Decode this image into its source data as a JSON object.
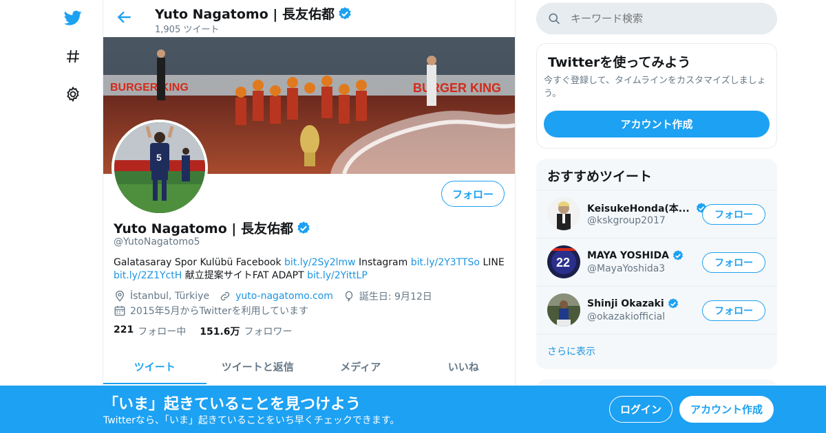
{
  "colors": {
    "accent": "#1da1f2",
    "link": "#1b95e0",
    "muted": "#657786",
    "text": "#14171a",
    "border": "#e6ecf0",
    "panel": "#f5f8fa"
  },
  "nav": {
    "icons": [
      "twitter-bird-icon",
      "hashtag-icon",
      "gear-icon"
    ]
  },
  "header": {
    "name": "Yuto Nagatomo | 長友佑都",
    "tweet_count": "1,905 ツイート"
  },
  "profile": {
    "name": "Yuto Nagatomo | 長友佑都",
    "handle": "@YutoNagatomo5",
    "follow_label": "フォロー",
    "bio": {
      "t1": "Galatasaray Spor Kulübü Facebook ",
      "l1": "bit.ly/2Sy2lmw",
      "t2": " Instagram ",
      "l2": "bit.ly/2Y3TTSo",
      "t3": " LINE ",
      "l3": "bit.ly/2Z1YctH",
      "t4": " 献立提案サイトFAT ADAPT ",
      "l4": "bit.ly/2YittLP"
    },
    "location": "İstanbul, Türkiye",
    "website": "yuto-nagatomo.com",
    "birthday": "誕生日: 9月12日",
    "joined": "2015年5月からTwitterを利用しています",
    "following_count": "221",
    "following_label": "フォロー中",
    "followers_count": "151.6万",
    "followers_label": "フォロワー"
  },
  "tabs": [
    "ツイート",
    "ツイートと返信",
    "メディア",
    "いいね"
  ],
  "search": {
    "placeholder": "キーワード検索"
  },
  "signup_card": {
    "title": "Twitterを使ってみよう",
    "text": "今すぐ登録して、タイムラインをカスタマイズしましょう。",
    "button": "アカウント作成"
  },
  "recommend": {
    "title": "おすすめツイート",
    "items": [
      {
        "name": "KeisukeHonda(本...",
        "handle": "@kskgroup2017",
        "button": "フォロー"
      },
      {
        "name": "MAYA YOSHIDA",
        "handle": "@MayaYoshida3",
        "button": "フォロー"
      },
      {
        "name": "Shinji Okazaki",
        "handle": "@okazakiofficial",
        "button": "フォロー"
      }
    ],
    "more": "さらに表示"
  },
  "bottom_bar": {
    "title": "「いま」起きていることを見つけよう",
    "subtitle": "Twitterなら、「いま」起きていることをいち早くチェックできます。",
    "login": "ログイン",
    "signup": "アカウント作成"
  }
}
